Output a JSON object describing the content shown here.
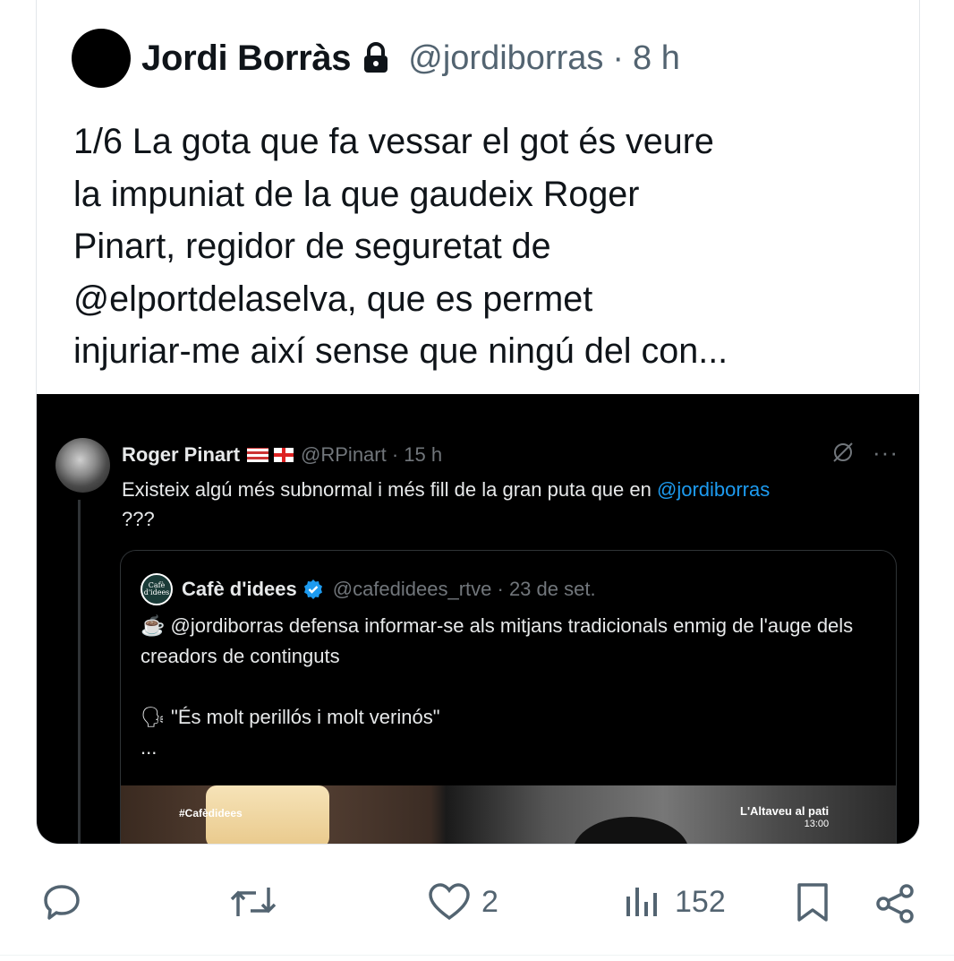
{
  "tweet": {
    "author_name": "Jordi Borràs",
    "handle": "@jordiborras",
    "separator": "·",
    "time": "8 h",
    "text": "1/6 La gota que fa vessar el got és veure\nla impuniat de la que gaudeix Roger\nPinart, regidor de seguretat de\n@elportdelaselva, que es permet\ninjuriar-me així sense que ningú del con..."
  },
  "embedded": {
    "author_name": "Roger Pinart",
    "handle": "@RPinart · 15 h",
    "text_before": "Existeix algú més subnormal i més fill de la gran puta que en ",
    "mention": "@jordiborras",
    "text_after": "???",
    "quote": {
      "logo_text": "Cafè d'idees",
      "name": "Cafè d'idees",
      "handle": "@cafedidees_rtve · 23 de set.",
      "line1": "☕ @jordiborras defensa informar-se als mitjans tradicionals enmig de l'auge dels creadors de continguts",
      "line2": "🗣 \"És molt perillós i molt verinós\"",
      "ellipsis": "...",
      "image_tag": "#Cafèdidees",
      "image_show": "L'Altaveu al pati",
      "image_time": "13:00"
    }
  },
  "actions": {
    "likes": "2",
    "views": "152"
  },
  "colors": {
    "text": "#0f1419",
    "secondary": "#536471",
    "link": "#1d9bf0",
    "verified": "#1d9bf0"
  },
  "icons": [
    "lock-icon",
    "reply-icon",
    "retweet-icon",
    "like-icon",
    "views-icon",
    "bookmark-icon",
    "share-icon",
    "verified-icon",
    "grok-icon",
    "more-icon"
  ]
}
